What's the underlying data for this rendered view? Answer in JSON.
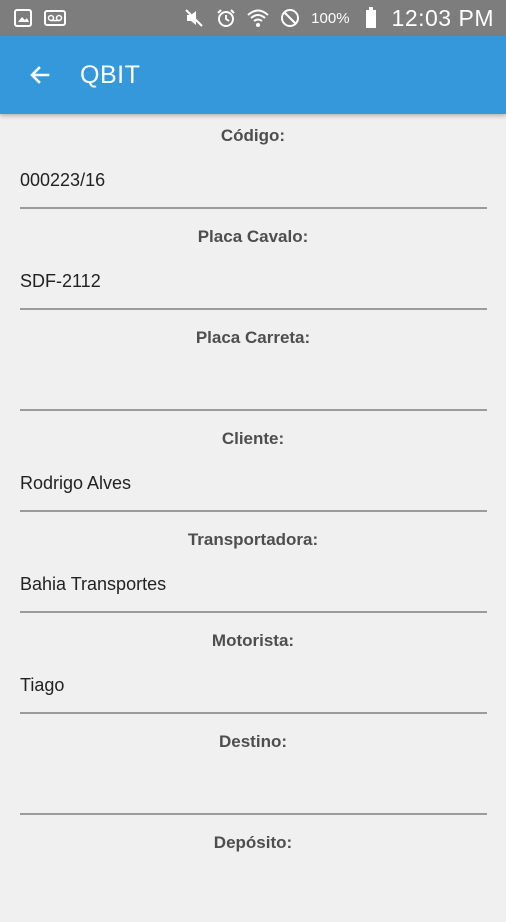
{
  "statusbar": {
    "battery_pct": "100%",
    "time": "12:03 PM",
    "icons": [
      "gallery-icon",
      "voicemail-icon",
      "mute-icon",
      "alarm-icon",
      "wifi-icon",
      "do-not-disturb-icon",
      "battery-icon"
    ]
  },
  "appbar": {
    "title": "QBIT",
    "back_icon": "arrow-left-icon"
  },
  "form": {
    "fields": [
      {
        "label": "Código:",
        "value": "000223/16"
      },
      {
        "label": "Placa Cavalo:",
        "value": "SDF-2112"
      },
      {
        "label": "Placa Carreta:",
        "value": ""
      },
      {
        "label": "Cliente:",
        "value": "Rodrigo Alves"
      },
      {
        "label": "Transportadora:",
        "value": "Bahia Transportes"
      },
      {
        "label": "Motorista:",
        "value": "Tiago"
      },
      {
        "label": "Destino:",
        "value": ""
      },
      {
        "label": "Depósito:",
        "value": ""
      }
    ]
  },
  "colors": {
    "appbar": "#3498db",
    "statusbar": "#7d7d7d",
    "background": "#f0f0f0"
  }
}
